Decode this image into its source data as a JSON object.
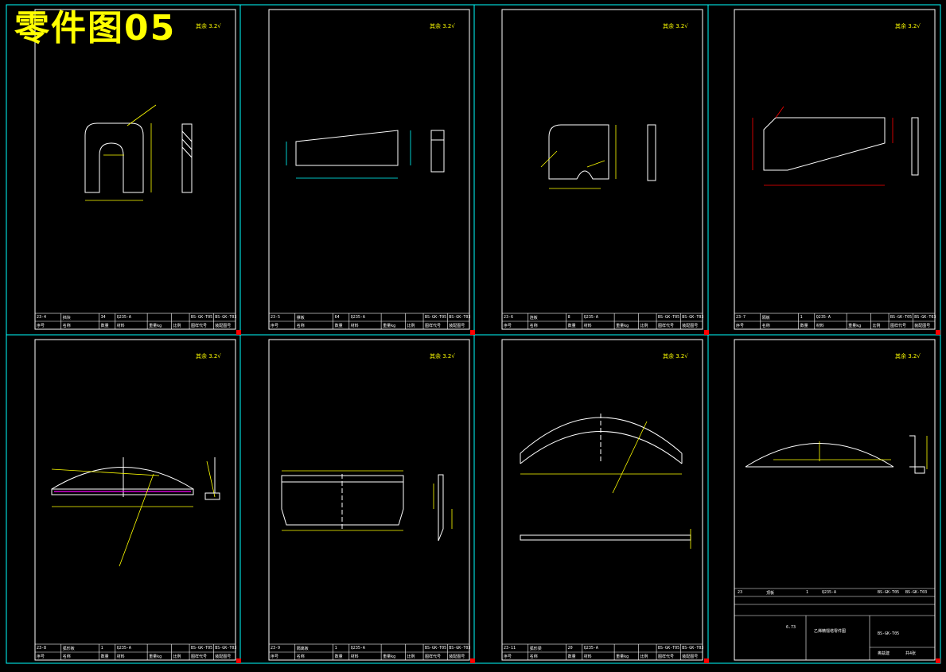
{
  "page_title": "零件图05",
  "surface_mark": "其余",
  "roughness_value": "3.2",
  "sheets": [
    {
      "id": "23-4",
      "name": "挡块",
      "qty": "34",
      "material": "Q235-A",
      "drawing_no": "BS-GK-T05",
      "assembly_no": "BS-GK-T03"
    },
    {
      "id": "23-5",
      "name": "撑板",
      "qty": "64",
      "material": "Q235-A",
      "drawing_no": "BS-GK-T05",
      "assembly_no": "BS-GK-T03"
    },
    {
      "id": "23-6",
      "name": "连板",
      "qty": "8",
      "material": "Q235-A",
      "drawing_no": "BS-GK-T05",
      "assembly_no": "BS-GK-T03"
    },
    {
      "id": "23-7",
      "name": "隔板",
      "qty": "1",
      "material": "Q235-A",
      "drawing_no": "BS-GK-T05",
      "assembly_no": "BS-GK-T03"
    },
    {
      "id": "23-8",
      "name": "弧形板",
      "qty": "1",
      "material": "Q235-A",
      "drawing_no": "BS-GK-T05",
      "assembly_no": "BS-GK-T03"
    },
    {
      "id": "23-9",
      "name": "隔离板",
      "qty": "1",
      "material": "Q235-A",
      "drawing_no": "BS-GK-T05",
      "assembly_no": "BS-GK-T03"
    },
    {
      "id": "23-11",
      "name": "弧形梁",
      "qty": "20",
      "material": "Q235-A",
      "drawing_no": "BS-GK-T05",
      "assembly_no": "BS-GK-T03"
    }
  ],
  "last_sheet": {
    "part_id": "23",
    "part_name": "顶板",
    "qty": "1",
    "material": "Q235-A",
    "drawing_title": "乙烯精馏塔零件图",
    "drawing_no": "BS-GK-T05",
    "scale": "6.73",
    "company": "奥兹建",
    "sheet_label": "共4张"
  },
  "header_labels": {
    "item": "序号",
    "name": "名称",
    "qty": "数量",
    "material": "材料",
    "weight": "重量kg",
    "scale": "比例",
    "drawing": "图样代号",
    "assembly": "装配图号"
  },
  "colors": {
    "background": "#000000",
    "frame": "#ffffff",
    "grid": "#00ffff",
    "dim": "#ffff00",
    "accent": "#ff0000"
  }
}
